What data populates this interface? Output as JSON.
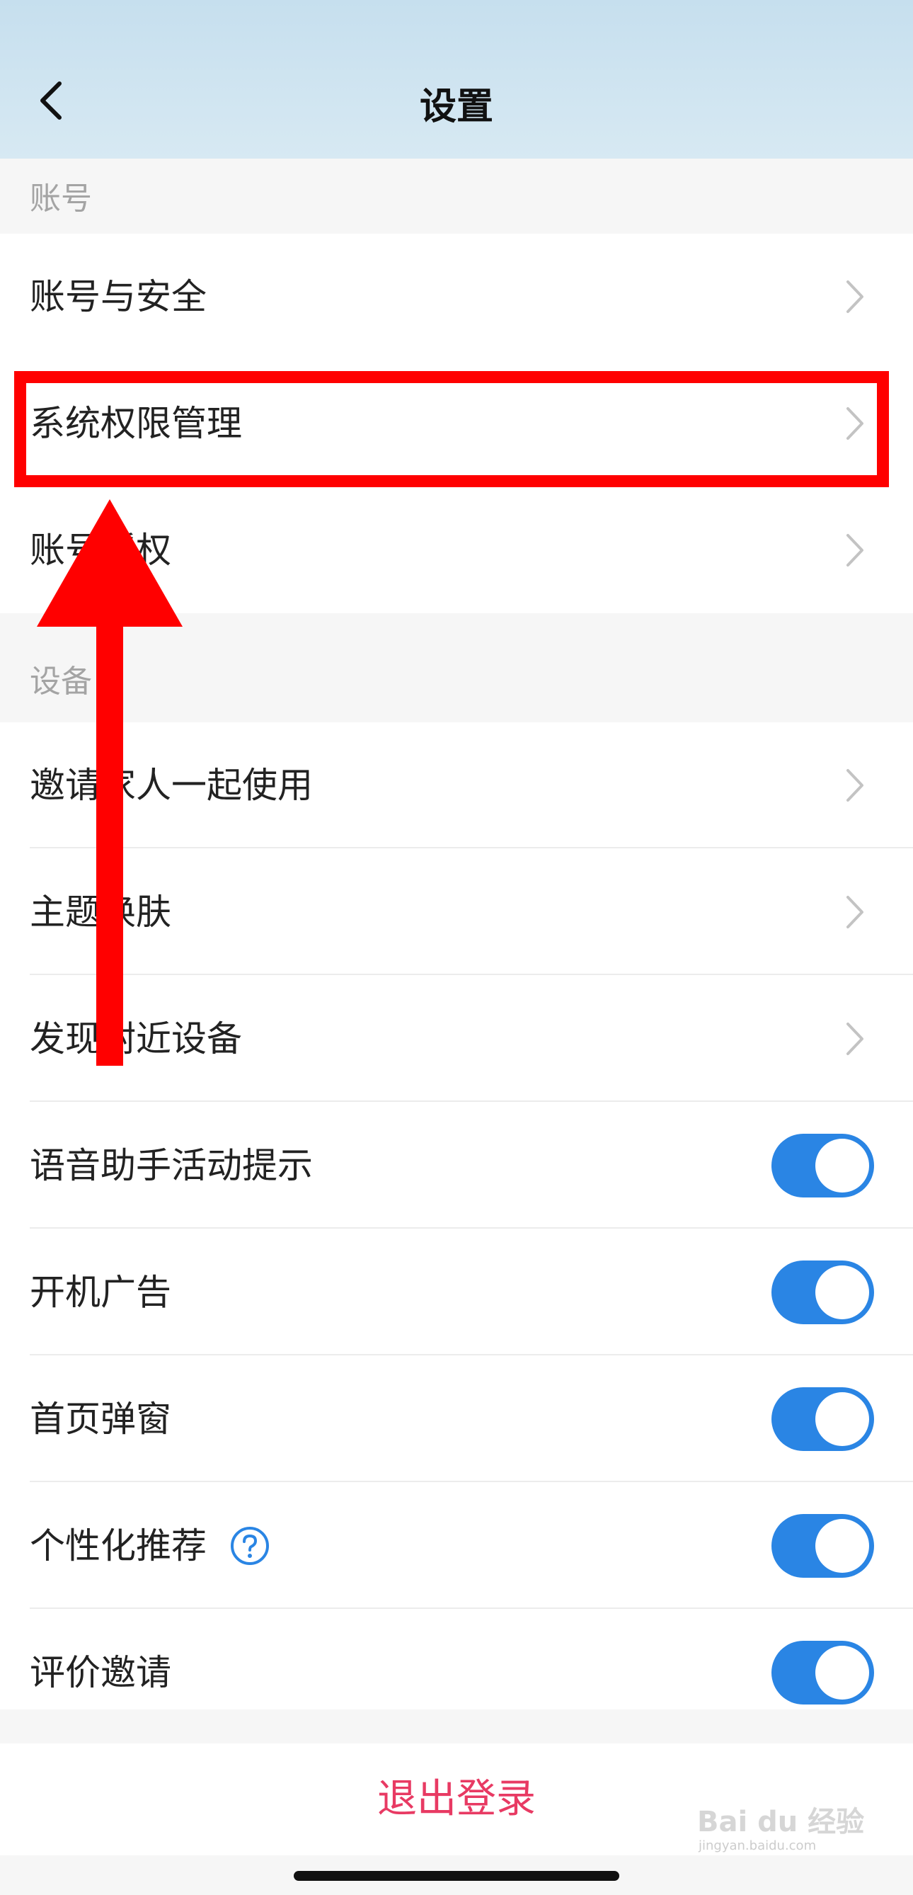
{
  "header": {
    "title": "设置"
  },
  "sections": {
    "account": {
      "label": "账号",
      "items": [
        {
          "label": "账号与安全"
        },
        {
          "label": "系统权限管理"
        },
        {
          "label": "账号授权"
        }
      ]
    },
    "device": {
      "label": "设备",
      "items": [
        {
          "label": "邀请家人一起使用"
        },
        {
          "label": "主题换肤"
        },
        {
          "label": "发现附近设备"
        }
      ]
    },
    "toggles": {
      "items": [
        {
          "label": "语音助手活动提示",
          "on": true
        },
        {
          "label": "开机广告",
          "on": true
        },
        {
          "label": "首页弹窗",
          "on": true
        },
        {
          "label": "个性化推荐",
          "on": true
        },
        {
          "label": "评价邀请",
          "on": true
        }
      ]
    }
  },
  "logout": {
    "label": "退出登录"
  },
  "watermark": {
    "text": "Bai du 经验",
    "sub": "jingyan.baidu.com"
  },
  "colors": {
    "toggle_on": "#2a85e4",
    "logout_text": "#e83a63",
    "highlight": "#ff0000"
  }
}
